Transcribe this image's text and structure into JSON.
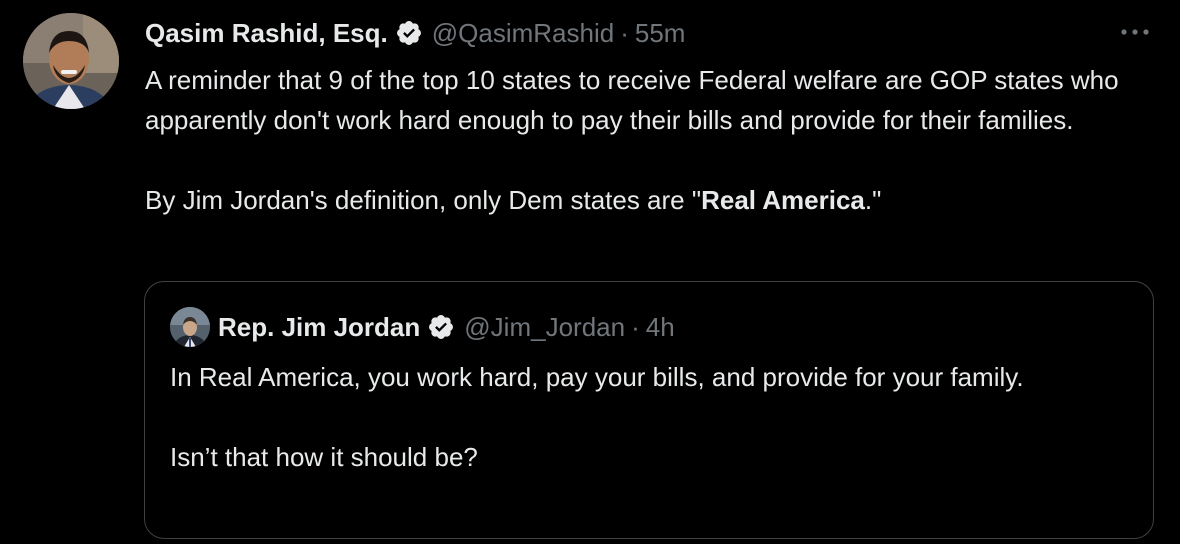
{
  "tweet": {
    "author": {
      "name": "Qasim Rashid, Esq.",
      "handle": "@QasimRashid",
      "separator": "·",
      "time": "55m"
    },
    "text": {
      "line1": "A reminder that 9 of the top 10 states to receive Federal welfare are GOP states who apparently don't work hard enough to pay their bills and provide for their families.",
      "line2_prefix": "By Jim Jordan's definition, only Dem states are \"",
      "line2_bold": "Real America",
      "line2_suffix": ".\""
    },
    "more_icon": "more-horizontal-icon",
    "verified_icon": "verified-badge-icon"
  },
  "quoted_tweet": {
    "author": {
      "name": "Rep. Jim Jordan",
      "handle": "@Jim_Jordan",
      "separator": "·",
      "time": "4h"
    },
    "text": {
      "line1": "In Real America, you work hard, pay your bills, and provide for your family.",
      "line2": "Isn’t that how it should be?"
    }
  },
  "colors": {
    "background": "#000000",
    "primary_text": "#e7e9ea",
    "secondary_text": "#71767b",
    "border": "#3e4144"
  }
}
